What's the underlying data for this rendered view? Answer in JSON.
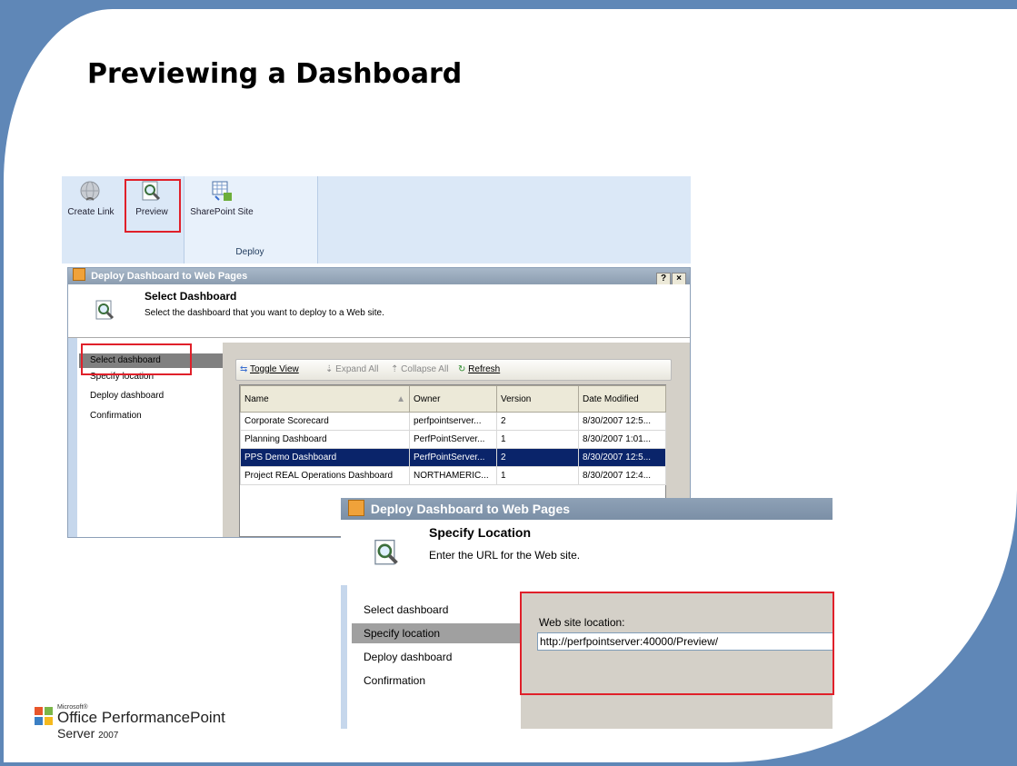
{
  "slide": {
    "title": "Previewing a Dashboard"
  },
  "ribbon": {
    "buttons": [
      {
        "label": "Create Link",
        "icon": "globe-link-icon"
      },
      {
        "label": "Preview",
        "icon": "magnifier-preview-icon"
      },
      {
        "label": "SharePoint Site",
        "icon": "sharepoint-site-icon"
      }
    ],
    "group_label": "Deploy"
  },
  "dialog1": {
    "title": "Deploy Dashboard to Web Pages",
    "title_buttons": [
      "?",
      "×"
    ],
    "header_title": "Select Dashboard",
    "header_desc": "Select the dashboard that you want to deploy to a Web site.",
    "nav": [
      "Select dashboard",
      "Specify location",
      "Deploy dashboard",
      "Confirmation"
    ],
    "toolbar": {
      "toggle_view": "Toggle View",
      "expand_all": "Expand All",
      "collapse_all": "Collapse All",
      "refresh": "Refresh"
    },
    "table": {
      "headers": [
        "Name",
        "Owner",
        "Version",
        "Date Modified"
      ],
      "rows": [
        [
          "Corporate Scorecard",
          "perfpointserver...",
          "2",
          "8/30/2007 12:5..."
        ],
        [
          "Planning Dashboard",
          "PerfPointServer...",
          "1",
          "8/30/2007 1:01..."
        ],
        [
          "PPS Demo Dashboard",
          "PerfPointServer...",
          "2",
          "8/30/2007 12:5..."
        ],
        [
          "Project REAL Operations Dashboard",
          "NORTHAMERIC...",
          "1",
          "8/30/2007 12:4..."
        ]
      ],
      "selected_row": 2
    }
  },
  "dialog2": {
    "title": "Deploy Dashboard to Web Pages",
    "header_title": "Specify Location",
    "header_desc": "Enter the URL for the Web site.",
    "nav": [
      "Select dashboard",
      "Specify location",
      "Deploy dashboard",
      "Confirmation"
    ],
    "field_label": "Web site location:",
    "field_value": "http://perfpointserver:40000/Preview/"
  },
  "logo": {
    "small": "Microsoft®",
    "line1": "Office PerformancePoint",
    "line2": "Server",
    "year": "2007"
  },
  "colors": {
    "frame": "#5f87b7",
    "highlight": "#e0202a",
    "selection": "#0a246a"
  }
}
